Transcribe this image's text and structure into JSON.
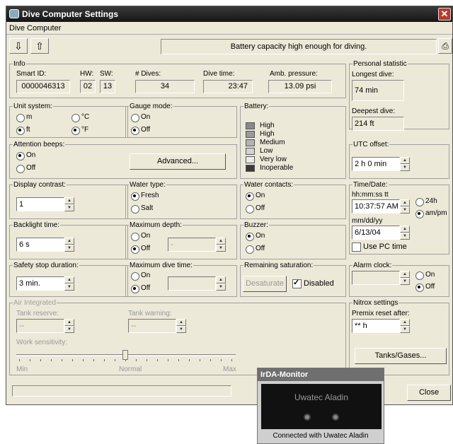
{
  "window": {
    "title": "Dive Computer Settings"
  },
  "menu": {
    "item": "Dive Computer"
  },
  "status": {
    "message": "Battery capacity high enough for diving."
  },
  "info": {
    "legend": "Info",
    "smart_id_label": "Smart ID:",
    "smart_id": "0000046313",
    "hw_label": "HW:",
    "hw": "02",
    "sw_label": "SW:",
    "sw": "13",
    "dives_label": "# Dives:",
    "dives": "34",
    "dive_time_label": "Dive time:",
    "dive_time": "23:47",
    "pressure_label": "Amb. pressure:",
    "pressure": "13.09 psi"
  },
  "personal": {
    "legend": "Personal statistic",
    "longest_label": "Longest dive:",
    "longest": "74 min",
    "deepest_label": "Deepest dive:",
    "deepest": "214 ft"
  },
  "units": {
    "legend": "Unit system:",
    "m": "m",
    "c": "°C",
    "ft": "ft",
    "f": "°F"
  },
  "gauge": {
    "legend": "Gauge mode:",
    "on": "On",
    "off": "Off"
  },
  "battery": {
    "legend": "Battery:",
    "levels": [
      {
        "label": "High",
        "color": "#8a8a8a"
      },
      {
        "label": "High",
        "color": "#9a9a9a"
      },
      {
        "label": "Medium",
        "color": "#b3b3b3"
      },
      {
        "label": "Low",
        "color": "#d3d3d3"
      },
      {
        "label": "Very low",
        "color": "#ececec"
      },
      {
        "label": "Inoperable",
        "color": "#3a3a3a"
      }
    ]
  },
  "beeps": {
    "legend": "Attention beeps:",
    "on": "On",
    "off": "Off",
    "advanced": "Advanced..."
  },
  "utc": {
    "legend": "UTC offset:",
    "value": "2 h 0 min"
  },
  "contrast": {
    "legend": "Display contrast:",
    "value": "1"
  },
  "water_type": {
    "legend": "Water type:",
    "fresh": "Fresh",
    "salt": "Salt"
  },
  "water_contacts": {
    "legend": "Water contacts:",
    "on": "On",
    "off": "Off"
  },
  "timedate": {
    "legend": "Time/Date:",
    "time_label": "hh:mm:ss tt",
    "time": "10:37:57 AM",
    "h24": "24h",
    "ampm": "am/pm",
    "date_label": "mm/dd/yy",
    "date": "6/13/04",
    "use_pc": "Use PC time"
  },
  "backlight": {
    "legend": "Backlight time:",
    "value": "6 s"
  },
  "max_depth": {
    "legend": "Maximum depth:",
    "on": "On",
    "off": "Off",
    "value": "-"
  },
  "buzzer": {
    "legend": "Buzzer:",
    "on": "On",
    "off": "Off"
  },
  "safety": {
    "legend": "Safety stop duration:",
    "value": "3 min."
  },
  "max_dive_time": {
    "legend": "Maximum dive time:",
    "on": "On",
    "off": "Off"
  },
  "saturation": {
    "legend": "Remaining saturation:",
    "desaturate": "Desaturate",
    "disabled": "Disabled"
  },
  "alarm": {
    "legend": "Alarm clock:",
    "on": "On",
    "off": "Off"
  },
  "air": {
    "legend": "Air Integrated",
    "reserve_label": "Tank reserve:",
    "reserve": "--",
    "warning_label": "Tank warning:",
    "warning": "--",
    "sensitivity_label": "Work sensitivity:",
    "min": "Min",
    "normal": "Normal",
    "max": "Max",
    "sensitivity_value": 0.5
  },
  "nitrox": {
    "legend": "Nitrox settings",
    "premix_label": "Premix reset after:",
    "premix": "** h",
    "tanks": "Tanks/Gases..."
  },
  "close": "Close",
  "monitor": {
    "title": "IrDA-Monitor",
    "brand": "Uwatec Aladin",
    "status": "Connected with Uwatec Aladin"
  }
}
